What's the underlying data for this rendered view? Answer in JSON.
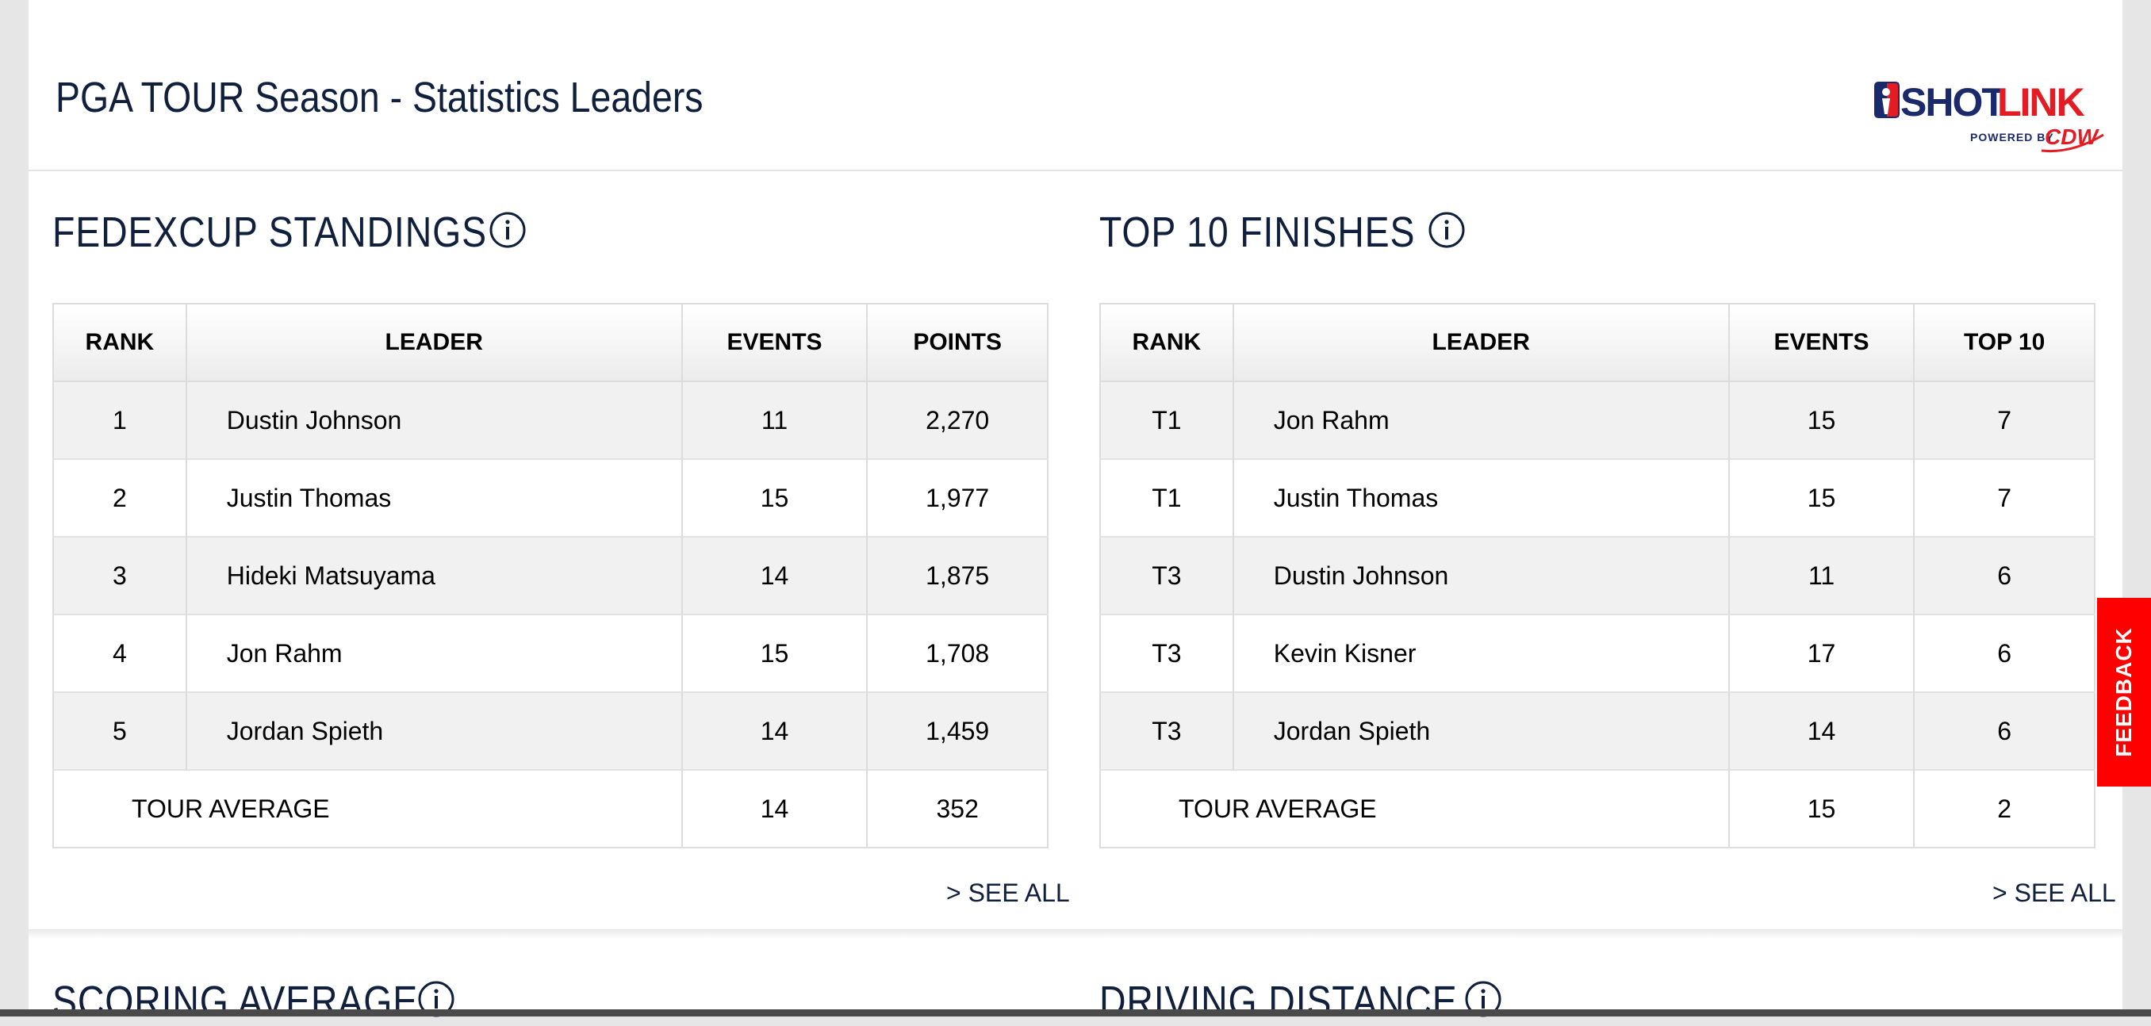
{
  "page": {
    "title": "PGA TOUR Season - Statistics Leaders"
  },
  "logo": {
    "brand": "SHOTLINK",
    "powered_by": "POWERED BY",
    "sponsor": "CDW",
    "colors": {
      "navy": "#1b2a6b",
      "red": "#e31b23"
    }
  },
  "sections": [
    {
      "title": "FEDEXCUP STANDINGS",
      "info_icon": "info-icon",
      "columns": [
        "RANK",
        "LEADER",
        "EVENTS",
        "POINTS"
      ],
      "rows": [
        {
          "rank": "1",
          "leader": "Dustin Johnson",
          "events": "11",
          "value": "2,270"
        },
        {
          "rank": "2",
          "leader": "Justin Thomas",
          "events": "15",
          "value": "1,977"
        },
        {
          "rank": "3",
          "leader": "Hideki Matsuyama",
          "events": "14",
          "value": "1,875"
        },
        {
          "rank": "4",
          "leader": "Jon Rahm",
          "events": "15",
          "value": "1,708"
        },
        {
          "rank": "5",
          "leader": "Jordan Spieth",
          "events": "14",
          "value": "1,459"
        }
      ],
      "average": {
        "label": "TOUR AVERAGE",
        "events": "14",
        "value": "352"
      },
      "see_all": "> SEE ALL"
    },
    {
      "title": "TOP 10 FINISHES",
      "info_icon": "info-icon",
      "columns": [
        "RANK",
        "LEADER",
        "EVENTS",
        "TOP 10"
      ],
      "rows": [
        {
          "rank": "T1",
          "leader": "Jon Rahm",
          "events": "15",
          "value": "7"
        },
        {
          "rank": "T1",
          "leader": "Justin Thomas",
          "events": "15",
          "value": "7"
        },
        {
          "rank": "T3",
          "leader": "Dustin Johnson",
          "events": "11",
          "value": "6"
        },
        {
          "rank": "T3",
          "leader": "Kevin Kisner",
          "events": "17",
          "value": "6"
        },
        {
          "rank": "T3",
          "leader": "Jordan Spieth",
          "events": "14",
          "value": "6"
        }
      ],
      "average": {
        "label": "TOUR AVERAGE",
        "events": "15",
        "value": "2"
      },
      "see_all": "> SEE ALL"
    },
    {
      "title": "SCORING AVERAGE",
      "info_icon": "info-icon"
    },
    {
      "title": "DRIVING DISTANCE",
      "info_icon": "info-icon"
    }
  ],
  "feedback": {
    "label": "FEEDBACK",
    "color": "#ff0000"
  }
}
